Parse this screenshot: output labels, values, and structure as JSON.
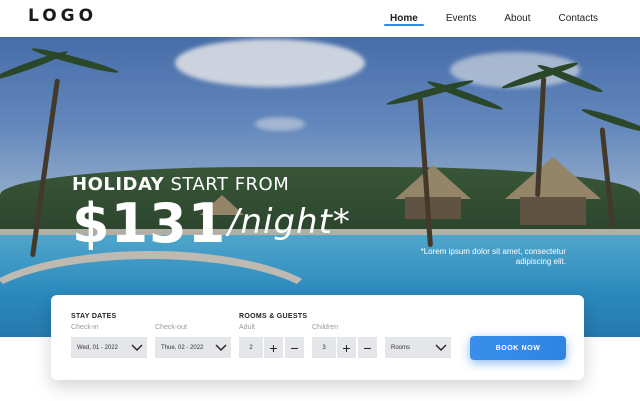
{
  "header": {
    "logo": "LOGO",
    "nav": [
      {
        "label": "Home",
        "active": true
      },
      {
        "label": "Events",
        "active": false
      },
      {
        "label": "About",
        "active": false
      },
      {
        "label": "Contacts",
        "active": false
      }
    ]
  },
  "hero": {
    "headline_bold": "HOLIDAY",
    "headline_rest": " START FROM",
    "price": "$131",
    "per_night": "/night*",
    "tagline": "*Lorem ipsum dolor sit amet, consectetur adipiscing elit."
  },
  "booking": {
    "stay_title": "STAY DATES",
    "checkin_label": "Check-in",
    "checkin_value": "Wed, 01 - 2022",
    "checkout_label": "Check-out",
    "checkout_value": "Thue, 02 - 2022",
    "rooms_title": "ROOMS & GUESTS",
    "adult_label": "Adult",
    "adult_value": "2",
    "children_label": "Children",
    "children_value": "3",
    "rooms_value": "Rooms",
    "plus": "+",
    "minus": "−",
    "book_label": "BOOK NOW"
  },
  "colors": {
    "accent": "#2f84e4",
    "field_bg": "#e5e6ea"
  }
}
